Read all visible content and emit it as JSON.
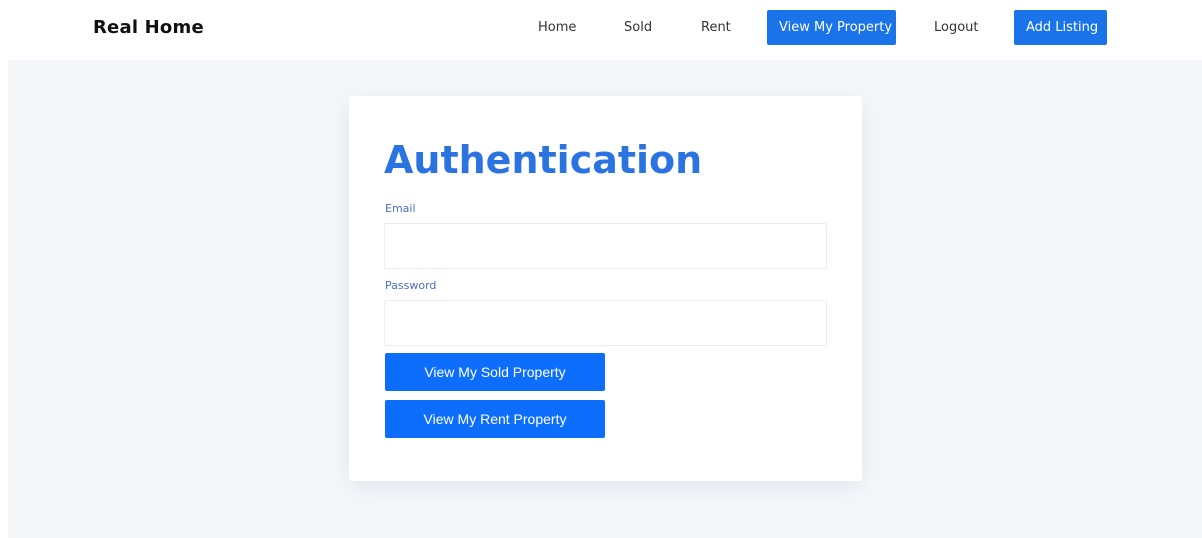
{
  "nav": {
    "brand": "Real Home",
    "home": "Home",
    "sold": "Sold",
    "rent": "Rent",
    "view_my_property": "View My Property",
    "logout": "Logout",
    "add_listing": "Add Listing"
  },
  "auth": {
    "title": "Authentication",
    "email_label": "Email",
    "email_value": "",
    "password_label": "Password",
    "password_value": "",
    "sold_button": "View My Sold Property",
    "rent_button": "View My Rent Property"
  },
  "colors": {
    "accent": "#1a73e8",
    "title": "#2a73e0",
    "page_bg": "#f5f7fa"
  }
}
